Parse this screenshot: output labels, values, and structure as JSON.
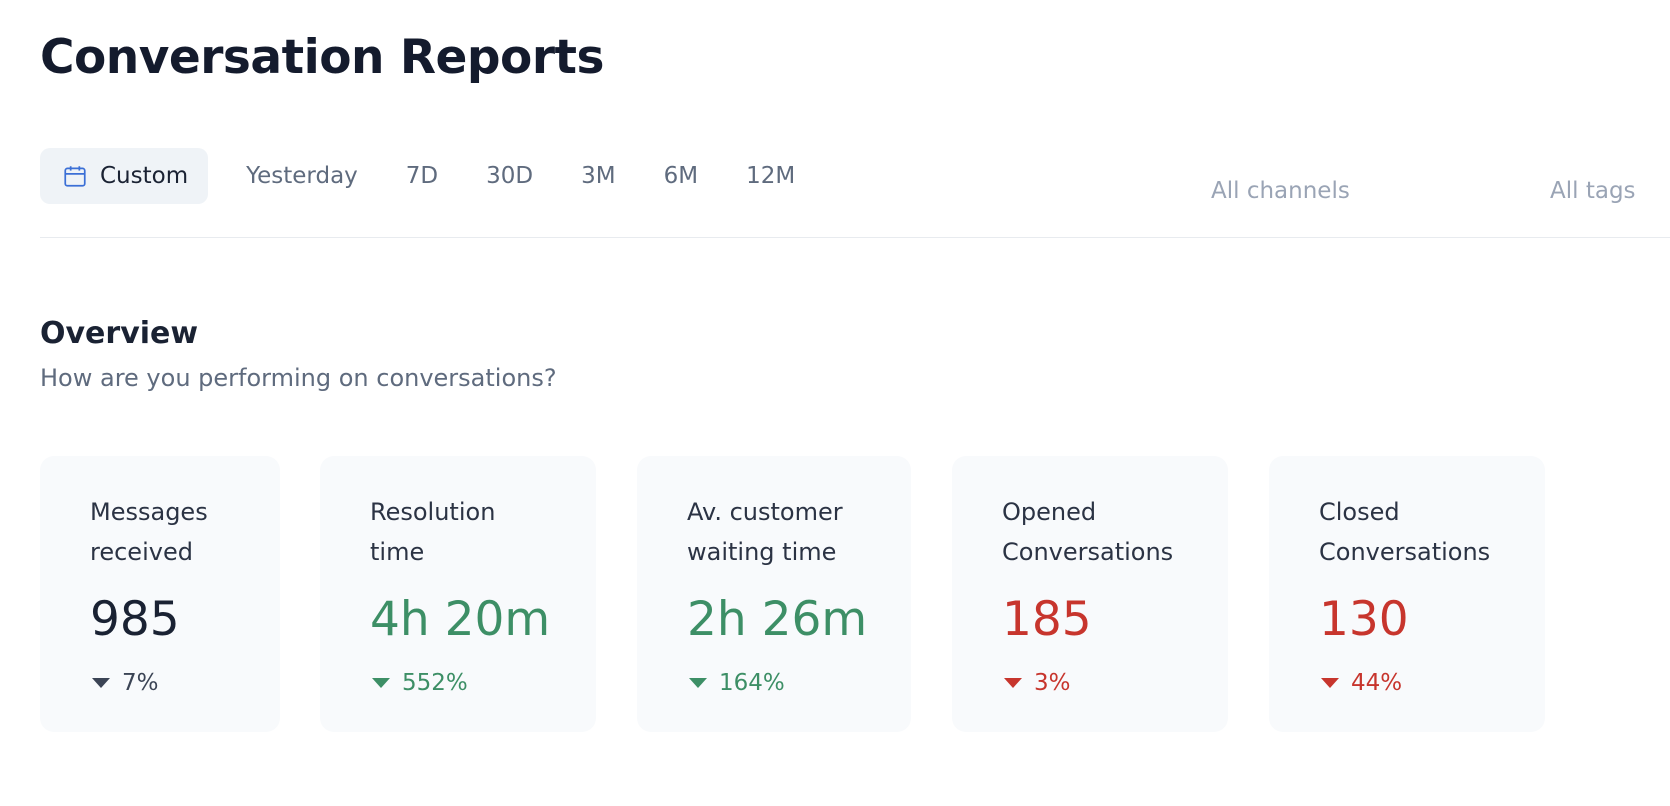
{
  "page": {
    "title": "Conversation Reports"
  },
  "filters": {
    "period_tabs": [
      {
        "label": "Custom",
        "icon": "calendar-icon",
        "active": true
      },
      {
        "label": "Yesterday"
      },
      {
        "label": "7D"
      },
      {
        "label": "30D"
      },
      {
        "label": "3M"
      },
      {
        "label": "6M"
      },
      {
        "label": "12M"
      }
    ],
    "channels": "All channels",
    "tags": "All tags"
  },
  "overview": {
    "title": "Overview",
    "subtitle": "How are you performing on conversations?",
    "cards": [
      {
        "label": "Messages\nreceived",
        "value": "985",
        "change": "7%",
        "trend_icon": "caret-down-icon",
        "color": "#3b4455"
      },
      {
        "label": "Resolution\ntime",
        "value": "4h 20m",
        "change": "552%",
        "trend_icon": "caret-down-icon",
        "color": "#3d8f66"
      },
      {
        "label": "Av. customer\nwaiting time",
        "value": "2h 26m",
        "change": "164%",
        "trend_icon": "caret-down-icon",
        "color": "#3d8f66"
      },
      {
        "label": "Opened\nConversations",
        "value": "185",
        "change": "3%",
        "trend_icon": "caret-down-icon",
        "color": "#c7352d"
      },
      {
        "label": "Closed\nConversations",
        "value": "130",
        "change": "44%",
        "trend_icon": "caret-down-icon",
        "color": "#c7352d"
      }
    ]
  }
}
